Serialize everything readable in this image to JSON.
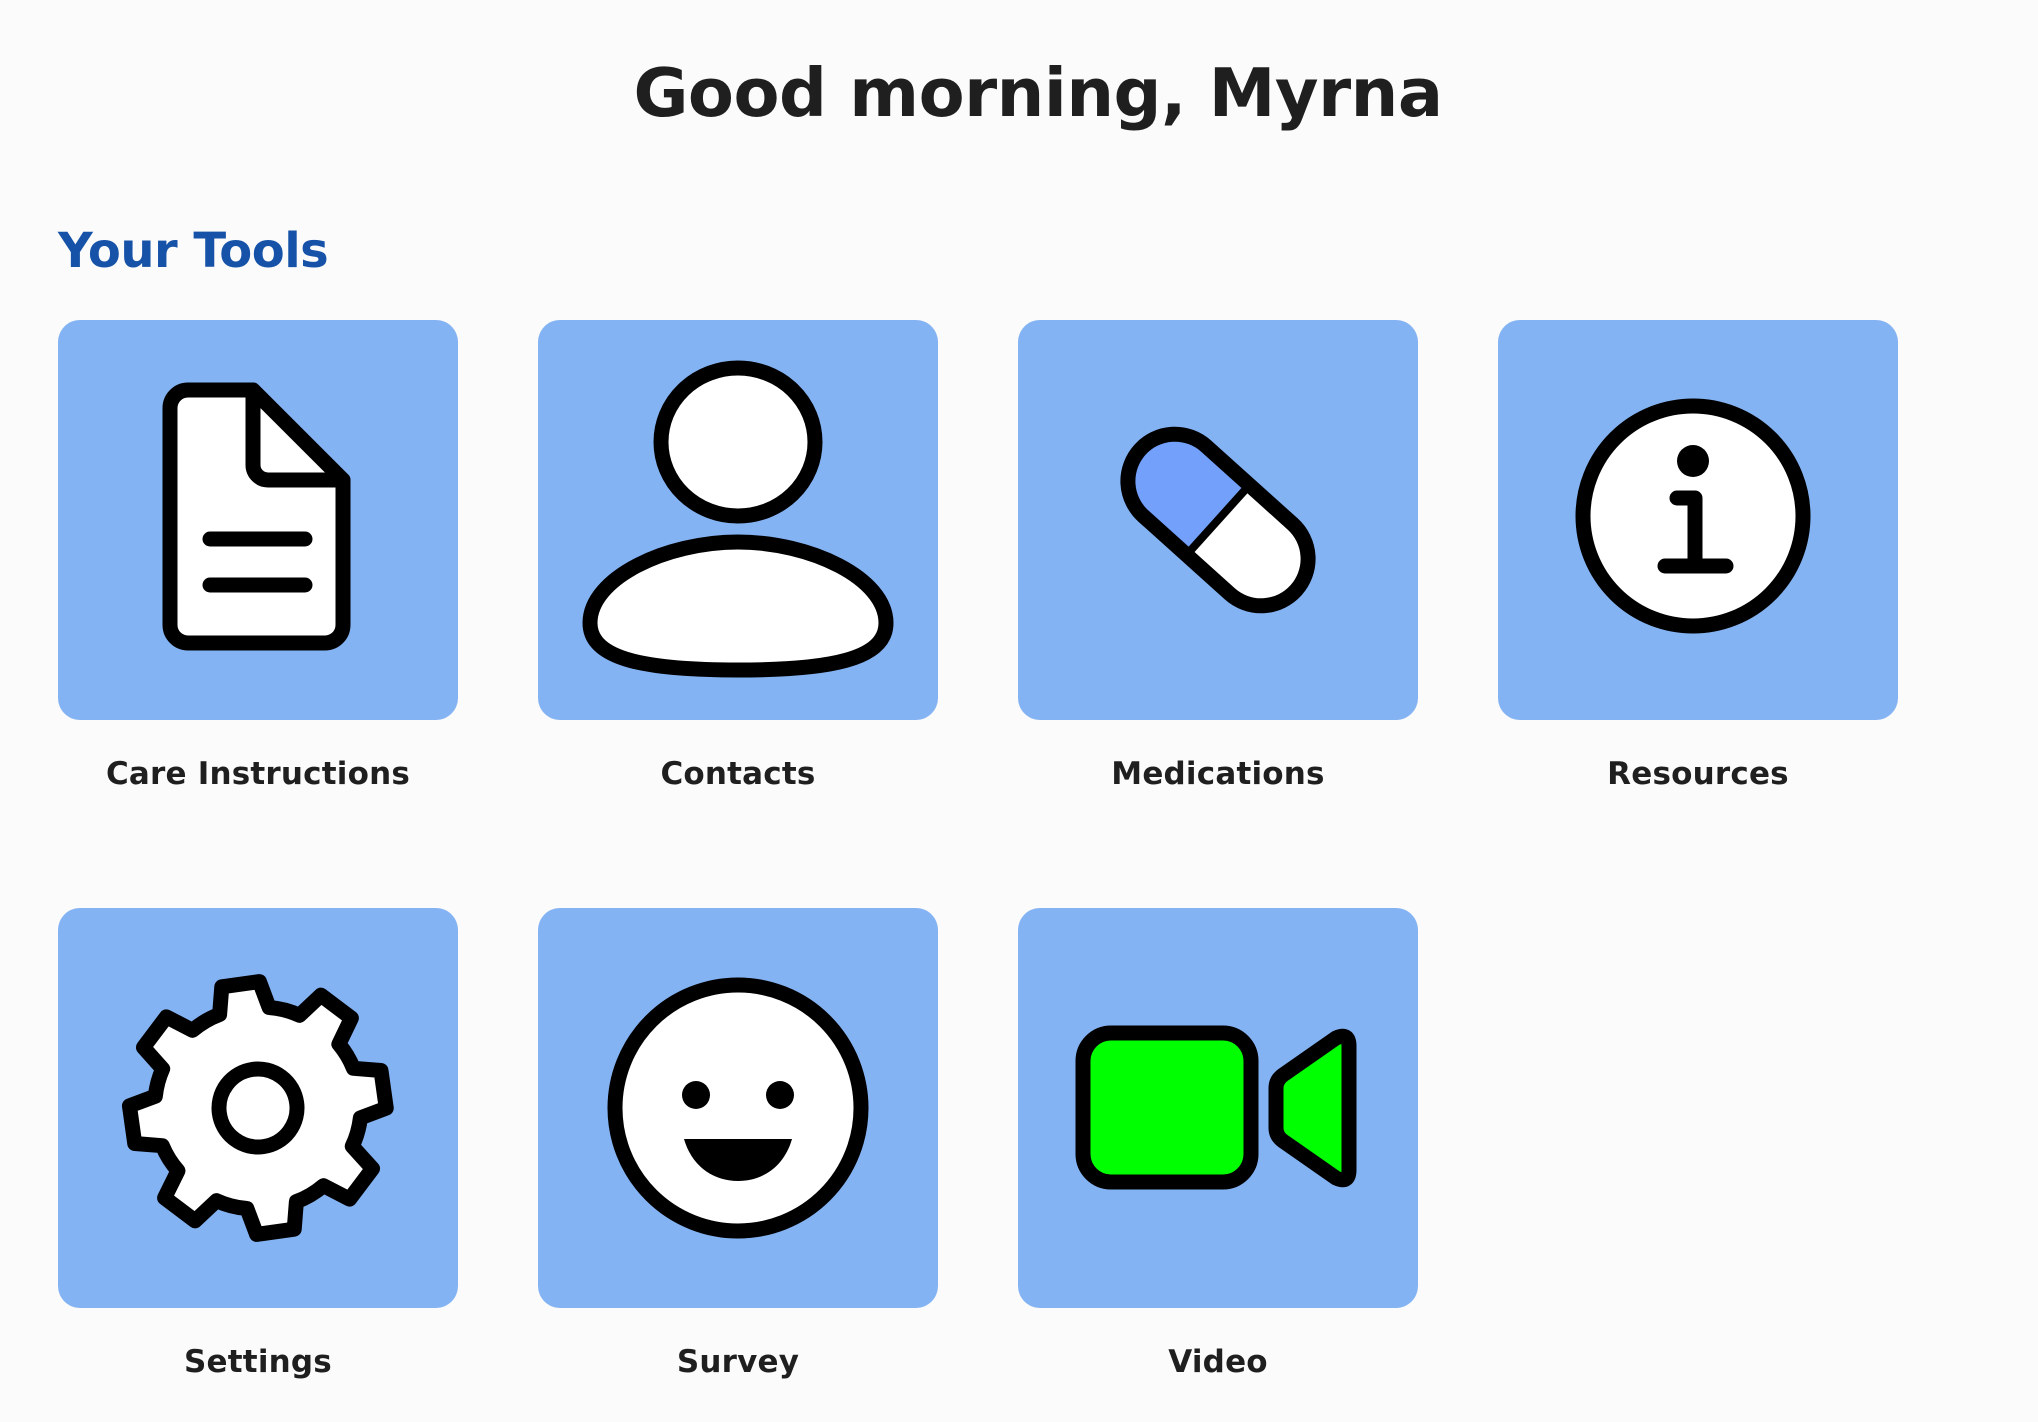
{
  "header": {
    "greeting": "Good morning, Myrna"
  },
  "tools_section": {
    "title": "Your Tools",
    "items": [
      {
        "label": "Care Instructions",
        "icon": "document-icon"
      },
      {
        "label": "Contacts",
        "icon": "person-icon"
      },
      {
        "label": "Medications",
        "icon": "pill-icon"
      },
      {
        "label": "Resources",
        "icon": "info-icon"
      },
      {
        "label": "Settings",
        "icon": "gear-icon"
      },
      {
        "label": "Survey",
        "icon": "smiley-face-icon"
      },
      {
        "label": "Video",
        "icon": "video-camera-icon"
      }
    ]
  },
  "colors": {
    "page_background": "#fbfbfb",
    "tile_background": "#84b3f3",
    "section_title": "#1552a8",
    "pill_blue_half": "#72a0fb",
    "video_camera_green": "#00ff00"
  }
}
